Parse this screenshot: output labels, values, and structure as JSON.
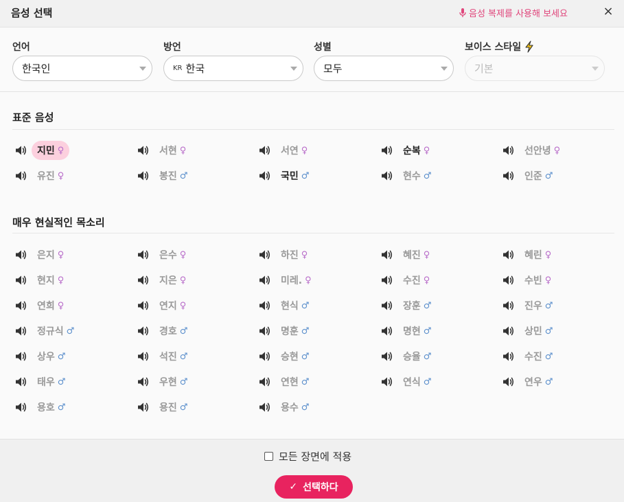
{
  "header": {
    "title": "음성 선택",
    "clone_link": "음성 복제를 사용해 보세요",
    "close_symbol": "×"
  },
  "filters": {
    "language": {
      "label": "언어",
      "value": "한국인"
    },
    "dialect": {
      "label": "방언",
      "flag": "KR",
      "value": "한국"
    },
    "gender": {
      "label": "성별",
      "value": "모두"
    },
    "style": {
      "label": "보이스 스타일",
      "value": "기본",
      "badge_icon": "lightning-icon"
    }
  },
  "sections": {
    "standard": {
      "title": "표준 음성"
    },
    "realistic": {
      "title": "매우 현실적인 목소리"
    }
  },
  "standard_voices": [
    {
      "name": "지민",
      "gender": "♀",
      "selected": true
    },
    {
      "name": "서현",
      "gender": "♀"
    },
    {
      "name": "서연",
      "gender": "♀"
    },
    {
      "name": "순복",
      "gender": "♀",
      "active": true
    },
    {
      "name": "선안녕",
      "gender": "♀"
    },
    {
      "name": "유진",
      "gender": "♀"
    },
    {
      "name": "봉진",
      "gender": "♂"
    },
    {
      "name": "국민",
      "gender": "♂",
      "active": true
    },
    {
      "name": "현수",
      "gender": "♂"
    },
    {
      "name": "인준",
      "gender": "♂"
    }
  ],
  "realistic_voices": [
    {
      "name": "은지",
      "gender": "♀"
    },
    {
      "name": "은수",
      "gender": "♀"
    },
    {
      "name": "하진",
      "gender": "♀"
    },
    {
      "name": "혜진",
      "gender": "♀"
    },
    {
      "name": "혜린",
      "gender": "♀"
    },
    {
      "name": "현지",
      "gender": "♀"
    },
    {
      "name": "지은",
      "gender": "♀"
    },
    {
      "name": "미레.",
      "gender": "♀"
    },
    {
      "name": "수진",
      "gender": "♀"
    },
    {
      "name": "수빈",
      "gender": "♀"
    },
    {
      "name": "연희",
      "gender": "♀"
    },
    {
      "name": "연지",
      "gender": "♀"
    },
    {
      "name": "현식",
      "gender": "♂"
    },
    {
      "name": "장훈",
      "gender": "♂"
    },
    {
      "name": "진우",
      "gender": "♂"
    },
    {
      "name": "정규식",
      "gender": "♂"
    },
    {
      "name": "경호",
      "gender": "♂"
    },
    {
      "name": "명훈",
      "gender": "♂"
    },
    {
      "name": "명현",
      "gender": "♂"
    },
    {
      "name": "상민",
      "gender": "♂"
    },
    {
      "name": "상우",
      "gender": "♂"
    },
    {
      "name": "석진",
      "gender": "♂"
    },
    {
      "name": "승현",
      "gender": "♂"
    },
    {
      "name": "승율",
      "gender": "♂"
    },
    {
      "name": "수진",
      "gender": "♂"
    },
    {
      "name": "태우",
      "gender": "♂"
    },
    {
      "name": "우현",
      "gender": "♂"
    },
    {
      "name": "연현",
      "gender": "♂"
    },
    {
      "name": "연식",
      "gender": "♂"
    },
    {
      "name": "연우",
      "gender": "♂"
    },
    {
      "name": "용호",
      "gender": "♂"
    },
    {
      "name": "용진",
      "gender": "♂"
    },
    {
      "name": "용수",
      "gender": "♂"
    }
  ],
  "footer": {
    "apply_all_label": "모든 장면에 적용",
    "select_button": "선택하다",
    "check_symbol": "✓"
  },
  "colors": {
    "accent": "#e8235f",
    "selected_bg": "#fcd0de",
    "female": "#b86cc9",
    "male": "#5b8fcc"
  }
}
